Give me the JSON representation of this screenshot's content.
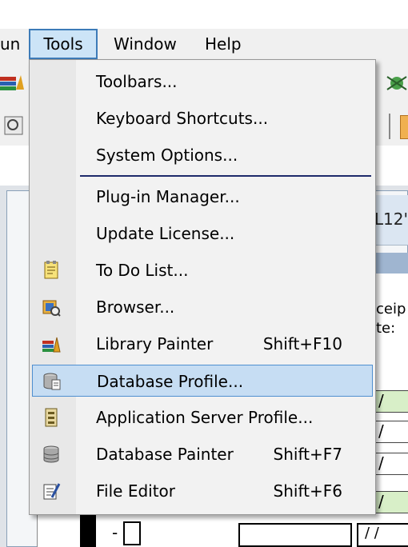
{
  "menubar": {
    "partial_left": "un",
    "tools": "Tools",
    "window": "Window",
    "help": "Help"
  },
  "background": {
    "title_fragment": "L12'",
    "label1": "ceip",
    "label2": "te:",
    "cell_slash": "/",
    "cell_date": "/ /",
    "dash": "-"
  },
  "tools_menu": {
    "items": [
      {
        "label": "Toolbars...",
        "shortcut": "",
        "icon": "none"
      },
      {
        "label": "Keyboard Shortcuts...",
        "shortcut": "",
        "icon": "none"
      },
      {
        "label": "System Options...",
        "shortcut": "",
        "icon": "none"
      },
      {
        "label": "Plug-in Manager...",
        "shortcut": "",
        "icon": "none"
      },
      {
        "label": "Update License...",
        "shortcut": "",
        "icon": "none"
      },
      {
        "label": "To Do List...",
        "shortcut": "",
        "icon": "todo-list-icon"
      },
      {
        "label": "Browser...",
        "shortcut": "",
        "icon": "browser-icon"
      },
      {
        "label": "Library Painter",
        "shortcut": "Shift+F10",
        "icon": "library-painter-icon"
      },
      {
        "label": "Database Profile...",
        "shortcut": "",
        "icon": "database-profile-icon"
      },
      {
        "label": "Application Server Profile...",
        "shortcut": "",
        "icon": "app-server-profile-icon"
      },
      {
        "label": "Database Painter",
        "shortcut": "Shift+F7",
        "icon": "database-painter-icon"
      },
      {
        "label": "File Editor",
        "shortcut": "Shift+F6",
        "icon": "file-editor-icon"
      }
    ],
    "highlighted": "Database Profile..."
  }
}
